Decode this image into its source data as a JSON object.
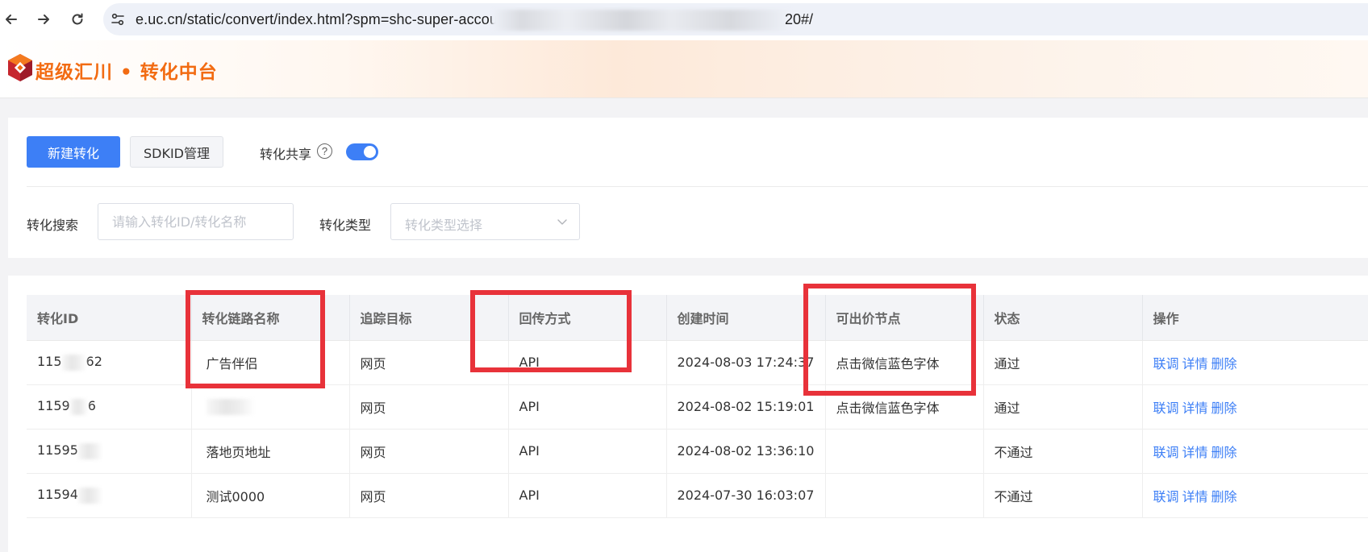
{
  "browser": {
    "url_visible": "e.uc.cn/static/convert/index.html?spm=shc-super-accou",
    "url_tail": "20#/"
  },
  "app": {
    "logo_text": "超级汇川 • 转化中台"
  },
  "toolbar": {
    "new_button": "新建转化",
    "sdkid_button": "SDKID管理",
    "share_label": "转化共享",
    "help_glyph": "?",
    "share_enabled": true
  },
  "filters": {
    "search_label": "转化搜索",
    "search_placeholder": "请输入转化ID/转化名称",
    "search_value": "",
    "type_label": "转化类型",
    "type_placeholder": "转化类型选择"
  },
  "table": {
    "columns": [
      "转化ID",
      "转化链路名称",
      "追踪目标",
      "回传方式",
      "创建时间",
      "可出价节点",
      "状态",
      "操作"
    ],
    "actions": [
      "联调",
      "详情",
      "删除"
    ],
    "rows": [
      {
        "id_prefix": "115",
        "id_suffix": "62",
        "name": "广告伴侣",
        "target": "网页",
        "method": "API",
        "created": "2024-08-03 17:24:37",
        "bid_node": "点击微信蓝色字体",
        "status": "通过"
      },
      {
        "id_prefix": "1159",
        "id_suffix": "6",
        "name": "",
        "target": "网页",
        "method": "API",
        "created": "2024-08-02 15:19:01",
        "bid_node": "点击微信蓝色字体",
        "status": "通过"
      },
      {
        "id_prefix": "11595",
        "id_suffix": "",
        "name": "落地页地址",
        "target": "网页",
        "method": "API",
        "created": "2024-08-02 13:36:10",
        "bid_node": "",
        "status": "不通过"
      },
      {
        "id_prefix": "11594",
        "id_suffix": "",
        "name": "测试0000",
        "target": "网页",
        "method": "API",
        "created": "2024-07-30 16:03:07",
        "bid_node": "",
        "status": "不通过"
      }
    ]
  },
  "colors": {
    "primary": "#3d7ff6",
    "brand_orange": "#f26b12",
    "annotation_red": "#e8323a"
  },
  "icons": [
    "back-arrow-icon",
    "forward-arrow-icon",
    "reload-icon",
    "site-settings-icon",
    "help-icon",
    "chevron-down-icon",
    "logo-icon"
  ]
}
